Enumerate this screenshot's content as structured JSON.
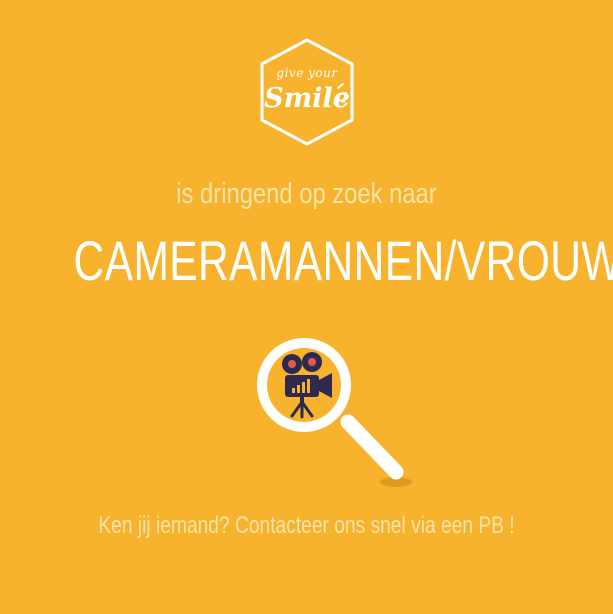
{
  "logo": {
    "line1": "give your",
    "line2": "Smile"
  },
  "subtitle": "is dringend op zoek naar",
  "headline": "CAMERAMANNEN/VROUWEN",
  "footer": "Ken jij iemand? Contacteer ons snel via een PB !",
  "colors": {
    "background": "#F7B32E",
    "text_light": "#FBE3A6",
    "white": "#ffffff",
    "lens_fill": "#F7B32E",
    "camera": "#2E2A4F",
    "signal_bars": "#F7B32E"
  },
  "icons": [
    "hexagon-logo",
    "magnifying-glass-icon",
    "movie-camera-icon"
  ]
}
